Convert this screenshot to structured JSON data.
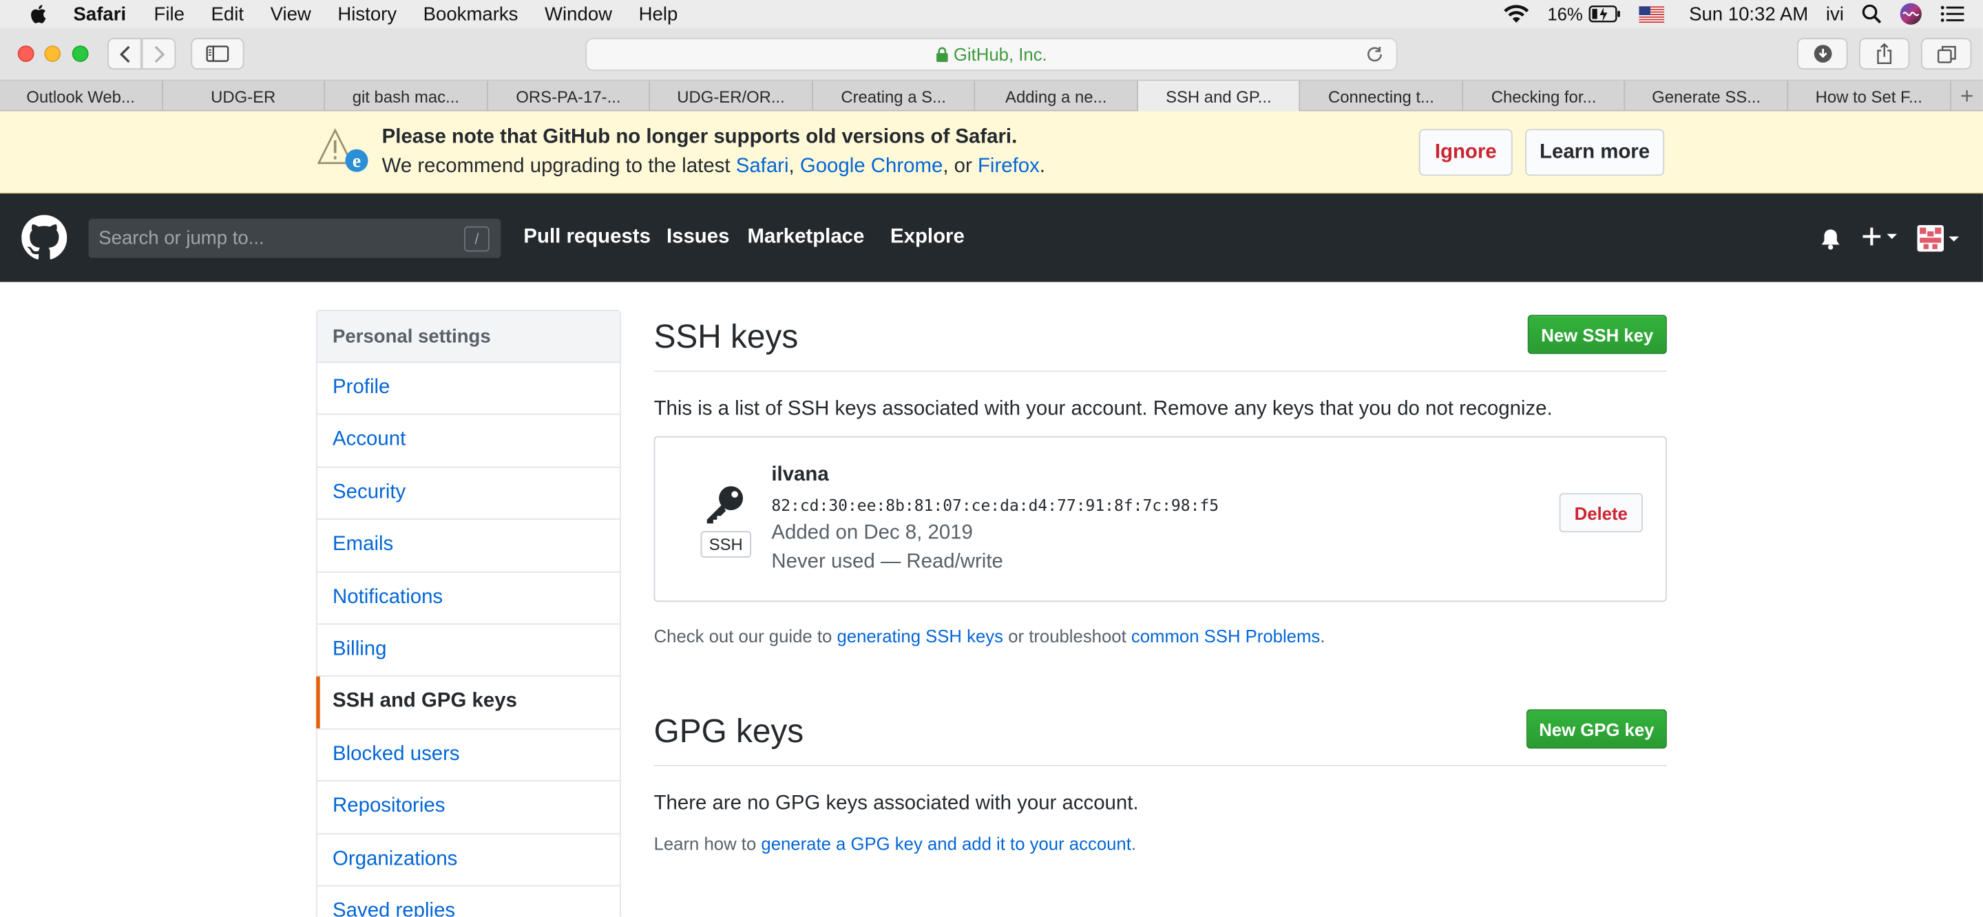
{
  "menubar": {
    "app": "Safari",
    "items": [
      "File",
      "Edit",
      "View",
      "History",
      "Bookmarks",
      "Window",
      "Help"
    ],
    "battery": "16%",
    "clock": "Sun 10:32 AM",
    "user": "ivi"
  },
  "toolbar": {
    "address": "GitHub, Inc."
  },
  "tabs": [
    {
      "label": "Outlook Web..."
    },
    {
      "label": "UDG-ER"
    },
    {
      "label": "git bash mac..."
    },
    {
      "label": "ORS-PA-17-..."
    },
    {
      "label": "UDG-ER/OR..."
    },
    {
      "label": "Creating a S..."
    },
    {
      "label": "Adding a ne..."
    },
    {
      "label": "SSH and GP..."
    },
    {
      "label": "Connecting t..."
    },
    {
      "label": "Checking for..."
    },
    {
      "label": "Generate SS..."
    },
    {
      "label": "How to Set F..."
    }
  ],
  "banner": {
    "title": "Please note that GitHub no longer supports old versions of Safari.",
    "line_prefix": "We recommend upgrading to the latest",
    "safari": "Safari",
    "sep1": ",",
    "chrome": "Google Chrome",
    "sep2": ", or",
    "firefox": "Firefox",
    "end": ".",
    "ignore": "Ignore",
    "learn_more": "Learn more"
  },
  "header": {
    "search_placeholder": "Search or jump to...",
    "search_shortcut": "/",
    "nav": [
      "Pull requests",
      "Issues",
      "Marketplace",
      "Explore"
    ]
  },
  "sidebar": {
    "heading": "Personal settings",
    "items": [
      {
        "label": "Profile"
      },
      {
        "label": "Account"
      },
      {
        "label": "Security"
      },
      {
        "label": "Emails"
      },
      {
        "label": "Notifications"
      },
      {
        "label": "Billing"
      },
      {
        "label": "SSH and GPG keys"
      },
      {
        "label": "Blocked users"
      },
      {
        "label": "Repositories"
      },
      {
        "label": "Organizations"
      },
      {
        "label": "Saved replies"
      }
    ]
  },
  "ssh": {
    "title": "SSH keys",
    "new_button": "New SSH key",
    "description": "This is a list of SSH keys associated with your account. Remove any keys that you do not recognize.",
    "key": {
      "badge": "SSH",
      "name": "ilvana",
      "fingerprint": "82:cd:30:ee:8b:81:07:ce:da:d4:77:91:8f:7c:98:f5",
      "added": "Added on Dec 8, 2019",
      "usage": "Never used — Read/write",
      "delete": "Delete"
    },
    "guide_prefix": "Check out our guide to",
    "guide_link1": "generating SSH keys",
    "guide_mid": "or troubleshoot",
    "guide_link2": "common SSH Problems",
    "guide_end": "."
  },
  "gpg": {
    "title": "GPG keys",
    "new_button": "New GPG key",
    "empty": "There are no GPG keys associated with your account.",
    "learn_prefix": "Learn how to",
    "learn_link": "generate a GPG key and add it to your account",
    "learn_end": "."
  },
  "colors": {
    "link": "#0366d6",
    "header_bg": "#24292e",
    "banner_bg": "#fff9d8",
    "active_accent": "#e36209",
    "green_button": "#2ea44f",
    "danger": "#cb2431"
  }
}
